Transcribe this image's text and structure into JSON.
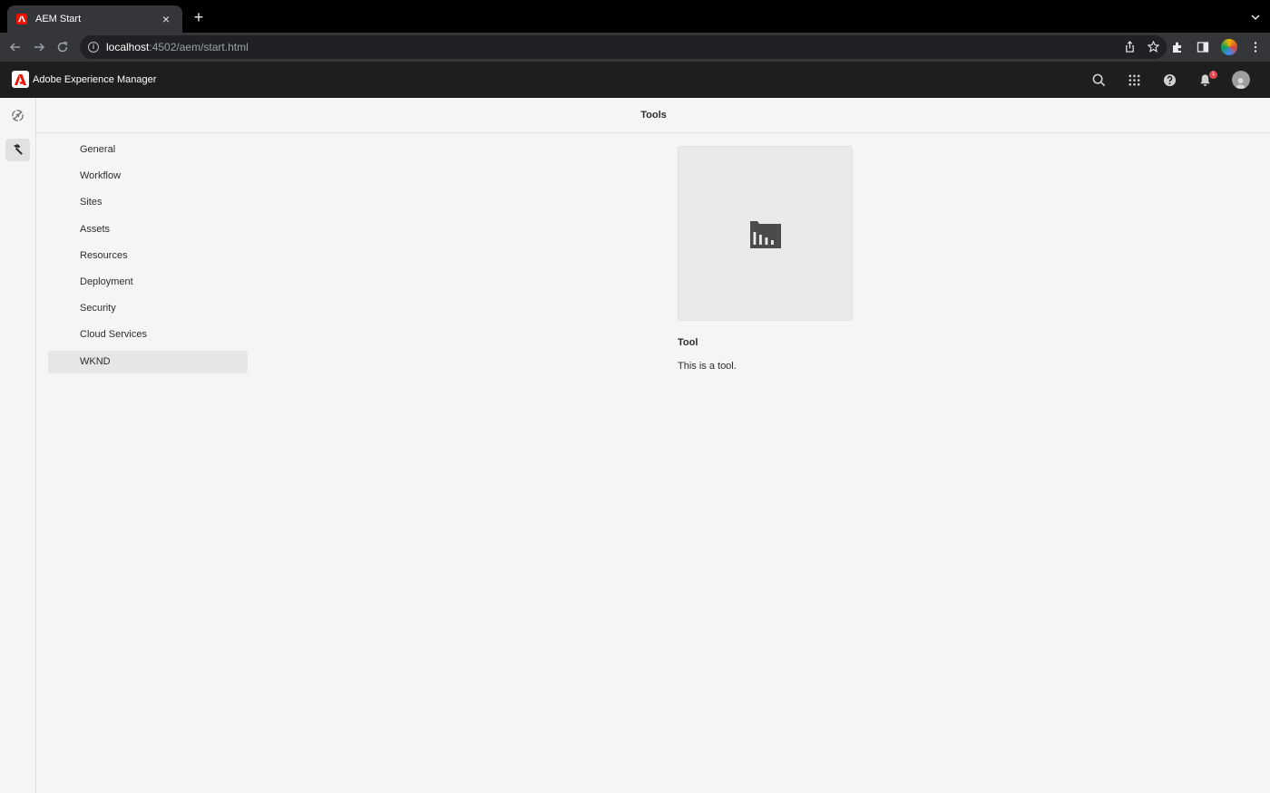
{
  "browser": {
    "tab_title": "AEM Start",
    "tab_close": "×",
    "new_tab": "+",
    "url_host": "localhost",
    "url_rest": ":4502/aem/start.html"
  },
  "shell": {
    "brand_name": "Adobe Experience Manager",
    "notification_count": "1"
  },
  "page": {
    "title": "Tools"
  },
  "categories": [
    {
      "label": "General"
    },
    {
      "label": "Workflow"
    },
    {
      "label": "Sites"
    },
    {
      "label": "Assets"
    },
    {
      "label": "Resources"
    },
    {
      "label": "Deployment"
    },
    {
      "label": "Security"
    },
    {
      "label": "Cloud Services"
    },
    {
      "label": "WKND",
      "selected": true
    }
  ],
  "tool_card": {
    "icon": "folder-chart-icon",
    "title": "Tool",
    "description": "This is a tool."
  },
  "colors": {
    "adobe_red": "#eb1000",
    "shell_bg": "#1e1e1e",
    "page_bg": "#f5f5f5",
    "badge_red": "#e34850"
  }
}
